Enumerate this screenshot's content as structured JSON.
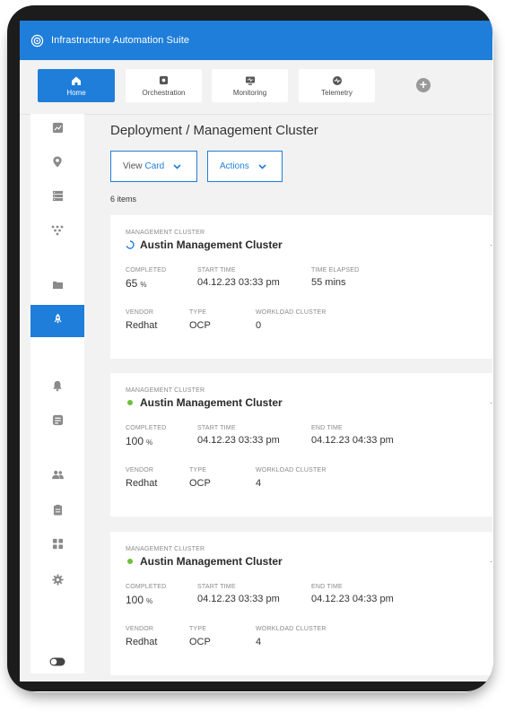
{
  "app": {
    "title": "Infrastructure Automation Suite"
  },
  "tabs": [
    {
      "label": "Home",
      "icon": "home-icon",
      "active": true
    },
    {
      "label": "Orchestration",
      "icon": "orchestration-icon",
      "active": false
    },
    {
      "label": "Monitoring",
      "icon": "monitor-icon",
      "active": false
    },
    {
      "label": "Telemetry",
      "icon": "telemetry-icon",
      "active": false
    }
  ],
  "sidebar": {
    "items": [
      {
        "icon": "analytics-icon"
      },
      {
        "icon": "location-pin-icon"
      },
      {
        "icon": "server-list-icon"
      },
      {
        "icon": "topology-icon"
      },
      {
        "icon": "folder-icon"
      },
      {
        "icon": "rocket-icon",
        "active": true
      },
      {
        "icon": "bell-icon"
      },
      {
        "icon": "checklist-icon"
      },
      {
        "icon": "users-icon"
      },
      {
        "icon": "clipboard-icon"
      },
      {
        "icon": "apps-grid-icon"
      },
      {
        "icon": "gear-icon"
      },
      {
        "icon": "toggle-icon"
      }
    ]
  },
  "main": {
    "breadcrumb": "Deployment / Management Cluster",
    "view_button": {
      "prefix": "View",
      "value": "Card"
    },
    "actions_button": "Actions",
    "item_count": "6 items"
  },
  "labels": {
    "section": "MANAGEMENT CLUSTER",
    "completed": "COMPLETED",
    "start_time": "START TIME",
    "time_elapsed": "TIME ELAPSED",
    "end_time": "END TIME",
    "vendor": "VENDOR",
    "type": "TYPE",
    "workload_cluster": "WORKLOAD CLUSTER",
    "percent": "%"
  },
  "clusters": [
    {
      "name": "Austin Management Cluster",
      "status": "in-progress",
      "completed": "65",
      "start_time": "04.12.23  03:33 pm",
      "third_value": "55 mins",
      "vendor": "Redhat",
      "type": "OCP",
      "workload_cluster": "0"
    },
    {
      "name": "Austin Management Cluster",
      "status": "complete",
      "completed": "100",
      "start_time": "04.12.23  03:33 pm",
      "third_value": "04.12.23  04:33 pm",
      "vendor": "Redhat",
      "type": "OCP",
      "workload_cluster": "4"
    },
    {
      "name": "Austin Management Cluster",
      "status": "complete",
      "completed": "100",
      "start_time": "04.12.23  03:33 pm",
      "third_value": "04.12.23  04:33 pm",
      "vendor": "Redhat",
      "type": "OCP",
      "workload_cluster": "4"
    }
  ],
  "colors": {
    "accent": "#1f7ed9",
    "success": "#6fbe3c",
    "background": "#f2f2f2"
  }
}
